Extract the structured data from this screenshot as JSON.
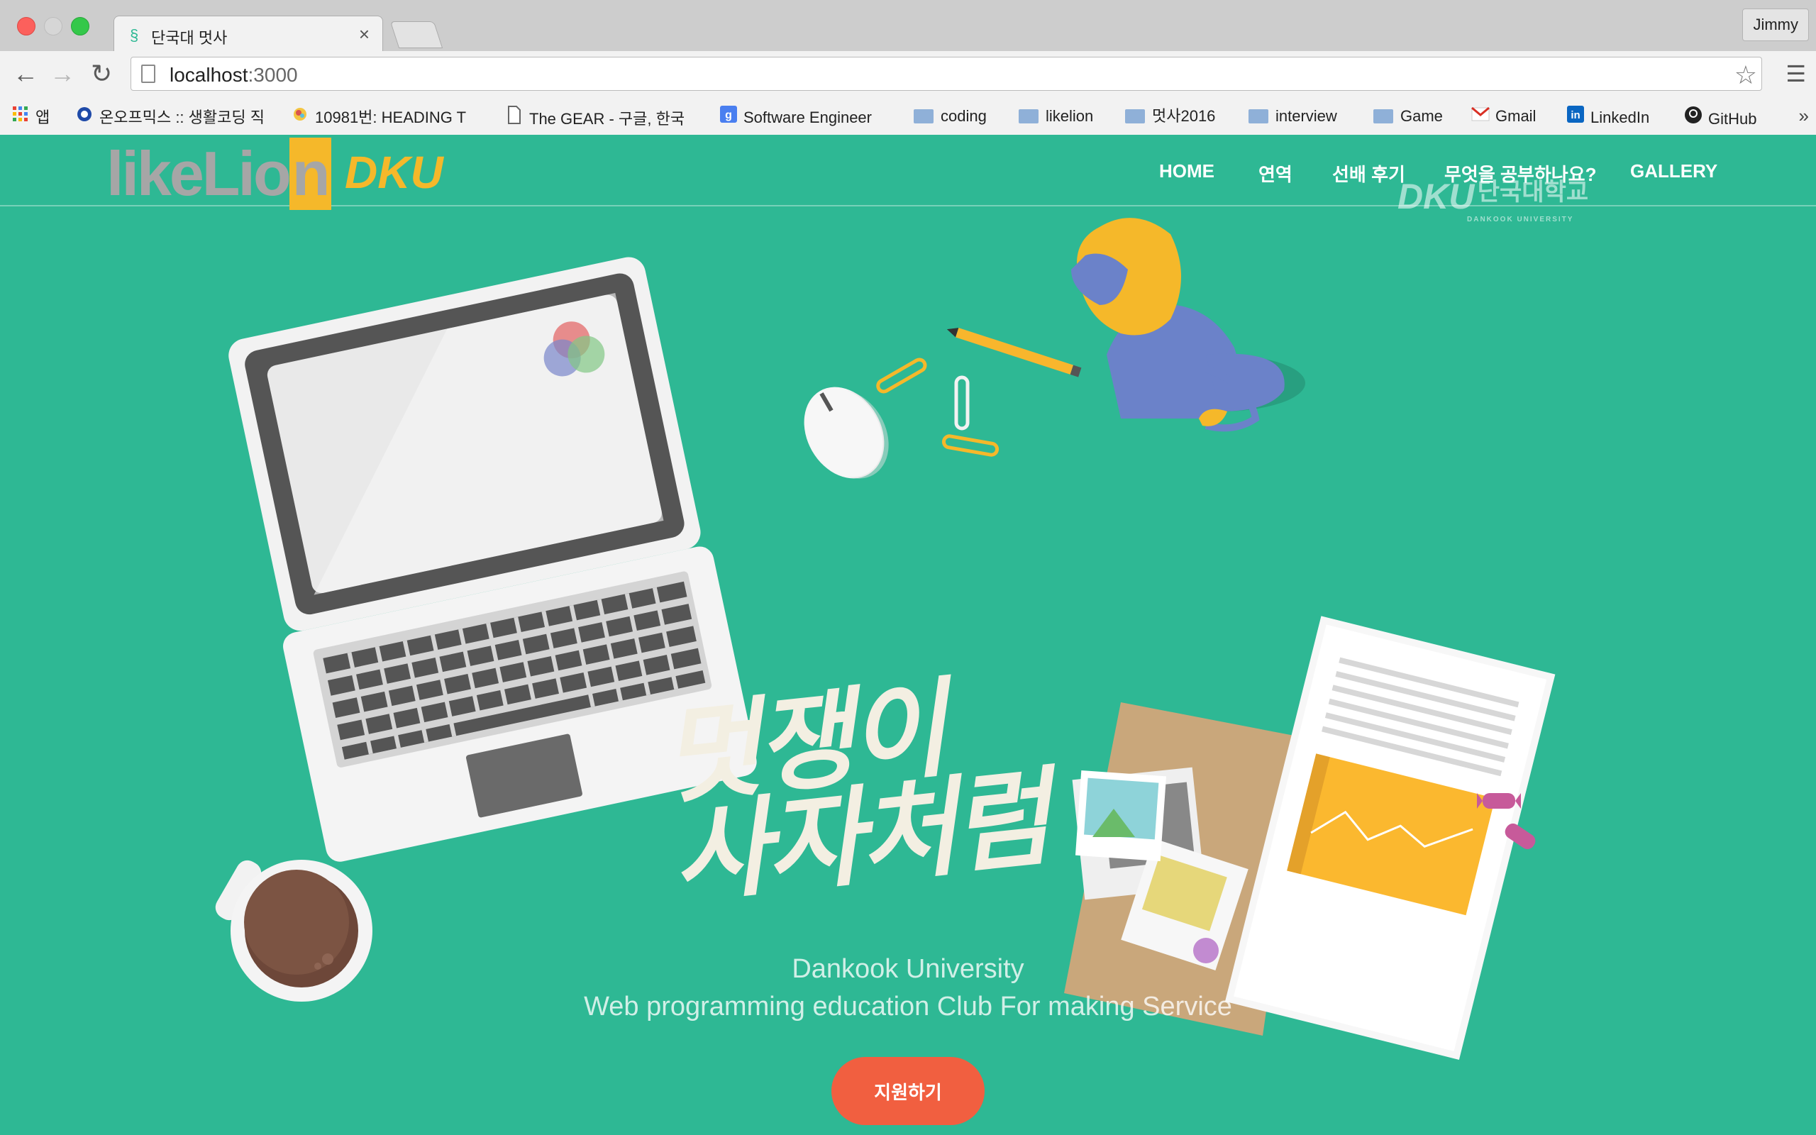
{
  "browser": {
    "tab_title": "단국대 멋사",
    "profile_name": "Jimmy",
    "url_host": "localhost",
    "url_port": ":3000",
    "bookmarks": [
      {
        "label": "앱",
        "icon": "apps-grid-icon"
      },
      {
        "label": "온오프믹스 :: 생활코딩 직",
        "icon": "onoffmix-icon"
      },
      {
        "label": "10981번: HEADING T",
        "icon": "acm-icon"
      },
      {
        "label": "The GEAR - 구글, 한국",
        "icon": "page-icon"
      },
      {
        "label": "Software Engineer",
        "icon": "google-icon"
      },
      {
        "label": "coding",
        "icon": "folder-icon"
      },
      {
        "label": "likelion",
        "icon": "folder-icon"
      },
      {
        "label": "멋사2016",
        "icon": "folder-icon"
      },
      {
        "label": "interview",
        "icon": "folder-icon"
      },
      {
        "label": "Game",
        "icon": "folder-icon"
      },
      {
        "label": "Gmail",
        "icon": "gmail-icon"
      },
      {
        "label": "LinkedIn",
        "icon": "linkedin-icon"
      },
      {
        "label": "GitHub",
        "icon": "github-icon"
      }
    ],
    "overflow_label": "»"
  },
  "site": {
    "logo_text": "likeLio",
    "logo_box_letter": "n",
    "logo_badge": "DKU",
    "nav": [
      "HOME",
      "연역",
      "선배 후기",
      "무엇을 공부하나요?",
      "GALLERY"
    ],
    "dku_logo_main": "DKU",
    "dku_logo_korean": "단국대학교",
    "dku_logo_english": "DANKOOK UNIVERSITY",
    "hero_title_line1": "멋쟁이",
    "hero_title_line2": "사자처럼",
    "subtitle_line1": "Dankook University",
    "subtitle_line2": "Web programming education Club For making Service",
    "apply_button": "지원하기"
  },
  "colors": {
    "background": "#2eb894",
    "apply_button": "#f15f40",
    "logo_accent": "#f5b82a"
  }
}
